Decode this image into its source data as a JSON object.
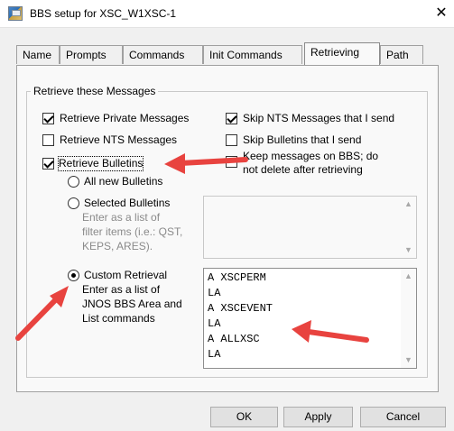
{
  "window": {
    "title": "BBS setup for XSC_W1XSC-1",
    "close_glyph": "✕"
  },
  "tabs": [
    {
      "label": "Name"
    },
    {
      "label": "Prompts"
    },
    {
      "label": "Commands"
    },
    {
      "label": "Init Commands"
    },
    {
      "label": "Retrieving",
      "active": true
    },
    {
      "label": "Path"
    }
  ],
  "group": {
    "title": "Retrieve these Messages",
    "retrieve_private": {
      "label": "Retrieve Private Messages",
      "checked": true
    },
    "skip_nts": {
      "label": "Skip NTS Messages that I send",
      "checked": true
    },
    "retrieve_nts": {
      "label": "Retrieve NTS Messages",
      "checked": false
    },
    "skip_bulletins": {
      "label": "Skip Bulletins that I send",
      "checked": false
    },
    "retrieve_bulletins": {
      "label": "Retrieve Bulletins",
      "checked": true
    },
    "keep_messages": {
      "label_line1": "Keep messages on BBS; do",
      "label_line2": "not delete after retrieving",
      "checked": false
    },
    "all_new": {
      "label": "All new Bulletins",
      "selected": false
    },
    "selected": {
      "label": "Selected Bulletins",
      "hint_line1": "Enter as a list of",
      "hint_line2": "filter items (i.e.: QST,",
      "hint_line3": "KEPS, ARES).",
      "selected": false,
      "value": ""
    },
    "custom": {
      "label": "Custom Retrieval",
      "hint_line1": "Enter as a list of",
      "hint_line2": "JNOS BBS Area and",
      "hint_line3": "List commands",
      "selected": true,
      "value": "A XSCPERM\nLA\nA XSCEVENT\nLA\nA ALLXSC\nLA"
    }
  },
  "buttons": {
    "ok": "OK",
    "apply": "Apply",
    "cancel": "Cancel"
  },
  "icons": {
    "scroll_up": "▲",
    "scroll_down": "▼"
  },
  "colors": {
    "annotation_arrow": "#e8433f"
  }
}
